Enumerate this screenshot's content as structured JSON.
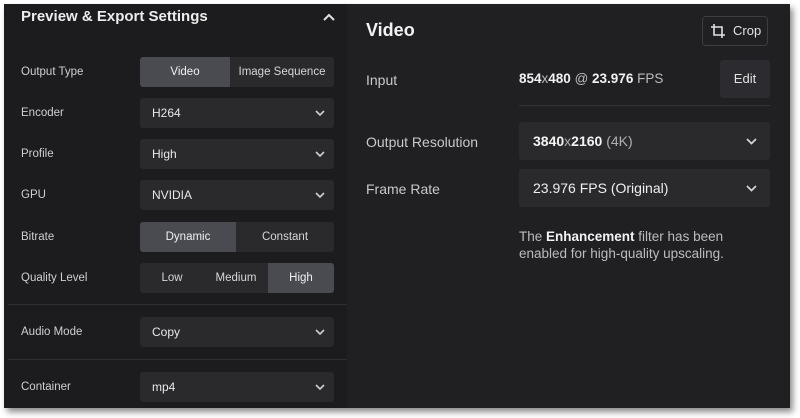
{
  "panel": {
    "title": "Preview & Export Settings",
    "collapse_icon": "chevron-up-icon"
  },
  "settings": {
    "output_type": {
      "label": "Output Type",
      "options": [
        "Video",
        "Image Sequence"
      ],
      "selected": "Video"
    },
    "encoder": {
      "label": "Encoder",
      "value": "H264"
    },
    "profile": {
      "label": "Profile",
      "value": "High"
    },
    "gpu": {
      "label": "GPU",
      "value": "NVIDIA"
    },
    "bitrate": {
      "label": "Bitrate",
      "options": [
        "Dynamic",
        "Constant"
      ],
      "selected": "Dynamic"
    },
    "quality_level": {
      "label": "Quality Level",
      "options": [
        "Low",
        "Medium",
        "High"
      ],
      "selected": "High"
    },
    "audio_mode": {
      "label": "Audio Mode",
      "value": "Copy"
    },
    "container": {
      "label": "Container",
      "value": "mp4"
    }
  },
  "video": {
    "title": "Video",
    "crop_button": "Crop",
    "crop_icon": "crop-icon",
    "input": {
      "label": "Input",
      "width": "854",
      "x": "x",
      "height": "480",
      "at": " @ ",
      "fps": "23.976",
      "fps_unit": " FPS"
    },
    "edit_button": "Edit",
    "output_resolution": {
      "label": "Output Resolution",
      "width": "3840",
      "x": "x",
      "height": "2160",
      "tag": " (4K)"
    },
    "frame_rate": {
      "label": "Frame Rate",
      "value": "23.976 FPS (Original)"
    },
    "notice": {
      "prefix": "The ",
      "bold": "Enhancement",
      "suffix": " filter has been enabled for high-quality upscaling."
    }
  },
  "colors": {
    "panel_bg": "#1c1c1e",
    "right_bg": "#202023",
    "control_bg": "#2a2a2d",
    "active_segment": "#4a4b50"
  }
}
